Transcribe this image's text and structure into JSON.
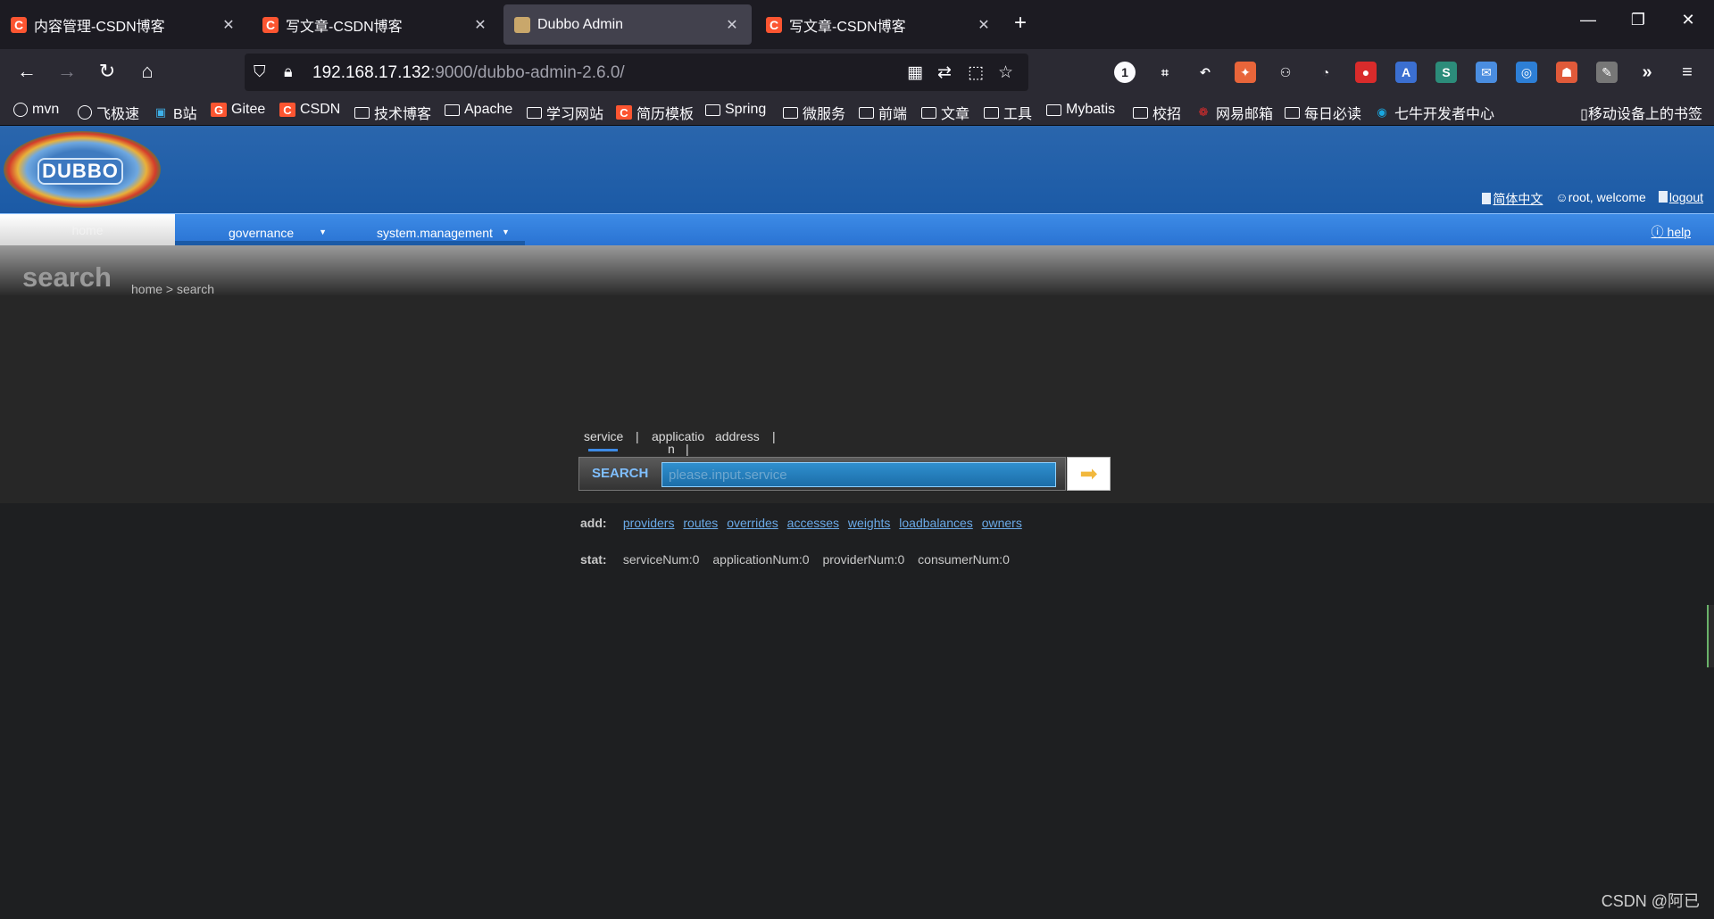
{
  "browser": {
    "tabs": [
      {
        "title": "内容管理-CSDN博客",
        "favicon": "C",
        "active": false
      },
      {
        "title": "写文章-CSDN博客",
        "favicon": "C",
        "active": false
      },
      {
        "title": "Dubbo Admin",
        "favicon": "dubbo",
        "active": true
      },
      {
        "title": "写文章-CSDN博客",
        "favicon": "C",
        "active": false
      }
    ],
    "url_host": "192.168.17.132",
    "url_rest": ":9000/dubbo-admin-2.6.0/",
    "bookmarks": [
      {
        "label": "mvn",
        "icon": "globe-icon"
      },
      {
        "label": "飞极速",
        "icon": "globe-icon"
      },
      {
        "label": "B站",
        "icon": "bilibili-icon"
      },
      {
        "label": "Gitee",
        "icon": "gitee-icon"
      },
      {
        "label": "CSDN",
        "icon": "csdn-icon"
      },
      {
        "label": "技术博客",
        "icon": "folder-icon"
      },
      {
        "label": "Apache",
        "icon": "folder-icon"
      },
      {
        "label": "学习网站",
        "icon": "folder-icon"
      },
      {
        "label": "简历模板",
        "icon": "csdn-icon"
      },
      {
        "label": "Spring",
        "icon": "folder-icon"
      },
      {
        "label": "微服务",
        "icon": "folder-icon"
      },
      {
        "label": "前端",
        "icon": "folder-icon"
      },
      {
        "label": "文章",
        "icon": "folder-icon"
      },
      {
        "label": "工具",
        "icon": "folder-icon"
      },
      {
        "label": "Mybatis",
        "icon": "folder-icon"
      },
      {
        "label": "校招",
        "icon": "folder-icon"
      },
      {
        "label": "网易邮箱",
        "icon": "mail-icon"
      },
      {
        "label": "每日必读",
        "icon": "folder-icon"
      },
      {
        "label": "七牛开发者中心",
        "icon": "qiniu-icon"
      }
    ],
    "mobile_bookmarks": "移动设备上的书签"
  },
  "header": {
    "logo_text": "DUBBO",
    "lang_link": "简体中文",
    "welcome": "root, welcome",
    "logout": "logout"
  },
  "menu": {
    "home": "home",
    "governance": "governance",
    "system_management": "system.management",
    "help": "help"
  },
  "page": {
    "title": "search",
    "breadcrumb": "home > search"
  },
  "search": {
    "tabs": [
      "service",
      "|",
      "applicatio",
      "n",
      "|",
      "address",
      "|"
    ],
    "label": "SEARCH",
    "placeholder": "please.input.service"
  },
  "add": {
    "label": "add:",
    "links": [
      "providers",
      "routes",
      "overrides",
      "accesses",
      "weights",
      "loadbalances",
      "owners"
    ]
  },
  "stat": {
    "label": "stat:",
    "values": [
      "serviceNum:0",
      "applicationNum:0",
      "providerNum:0",
      "consumerNum:0"
    ]
  },
  "watermark": "CSDN @阿已"
}
